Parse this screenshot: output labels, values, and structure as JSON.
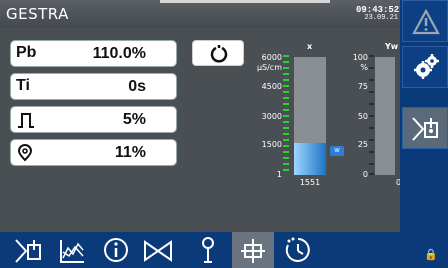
{
  "header": {
    "brand": "GESTRA",
    "time": "09:43:52",
    "date": "23.09.21"
  },
  "params": [
    {
      "label": "Pb",
      "value": "110.0%"
    },
    {
      "label": "Ti",
      "value": "0s"
    },
    {
      "label": "",
      "value": "5%",
      "icon": "step-icon"
    },
    {
      "label": "",
      "value": "11%",
      "icon": "valve-position-icon"
    }
  ],
  "gauge_x": {
    "title": "x",
    "unit_top": "6000",
    "unit": "μS/cm",
    "ticks": [
      "4500",
      "3000",
      "1500",
      "1"
    ],
    "value": "1551",
    "setpoint_marker": "w"
  },
  "gauge_yw": {
    "title": "Yw",
    "ticks": [
      "100",
      "%",
      "75",
      "50",
      "25",
      "0"
    ],
    "value": "0"
  },
  "lock_label": "🔒"
}
